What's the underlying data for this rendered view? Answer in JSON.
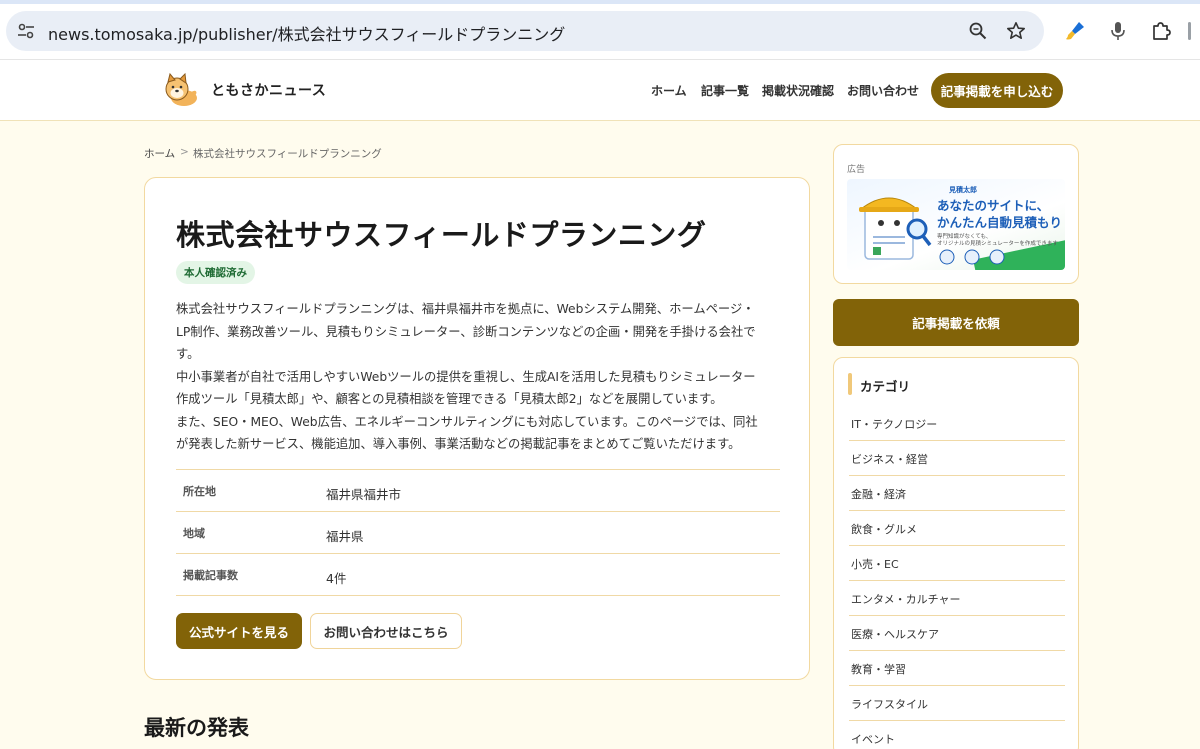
{
  "browser": {
    "url": "news.tomosaka.jp/publisher/株式会社サウスフィールドプランニング"
  },
  "header": {
    "logo_text": "ともさかニュース",
    "nav": [
      "ホーム",
      "記事一覧",
      "掲載状況確認",
      "お問い合わせ"
    ],
    "cta": "記事掲載を申し込む"
  },
  "breadcrumb": {
    "home": "ホーム",
    "sep": ">",
    "current": "株式会社サウスフィールドプランニング"
  },
  "company": {
    "name": "株式会社サウスフィールドプランニング",
    "badge": "本人確認済み",
    "description": [
      "株式会社サウスフィールドプランニングは、福井県福井市を拠点に、Webシステム開発、ホームページ・",
      "LP制作、業務改善ツール、見積もりシミュレーター、診断コンテンツなどの企画・開発を手掛ける会社で",
      "す。",
      "中小事業者が自社で活用しやすいWebツールの提供を重視し、生成AIを活用した見積もりシミュレーター",
      "作成ツール「見積太郎」や、顧客との見積相談を管理できる「見積太郎2」などを展開しています。",
      "また、SEO・MEO、Web広告、エネルギーコンサルティングにも対応しています。このページでは、同社",
      "が発表した新サービス、機能追加、導入事例、事業活動などの掲載記事をまとめてご覧いただけます。"
    ],
    "info": [
      {
        "label": "所在地",
        "value": "福井県福井市"
      },
      {
        "label": "地域",
        "value": "福井県"
      },
      {
        "label": "掲載記事数",
        "value": "4件"
      }
    ],
    "btn_site": "公式サイトを見る",
    "btn_contact": "お問い合わせはこちら"
  },
  "latest": {
    "title": "最新の発表"
  },
  "sidebar": {
    "ad": {
      "label": "広告",
      "brand": "見積太郎",
      "headline1": "あなたのサイトに、",
      "headline2": "かんたん自動見積もり",
      "sub1": "専門知識がなくても、",
      "sub2": "オリジナルの見積シミュレーターを作成できます"
    },
    "cta": "記事掲載を依頼",
    "category_heading": "カテゴリ",
    "categories": [
      "IT・テクノロジー",
      "ビジネス・経営",
      "金融・経済",
      "飲食・グルメ",
      "小売・EC",
      "エンタメ・カルチャー",
      "医療・ヘルスケア",
      "教育・学習",
      "ライフスタイル",
      "イベント"
    ]
  },
  "colors": {
    "brand": "#826308",
    "page_bg": "#fffcee",
    "border": "#f2d9a0",
    "badge_bg": "#e3f5e6"
  }
}
